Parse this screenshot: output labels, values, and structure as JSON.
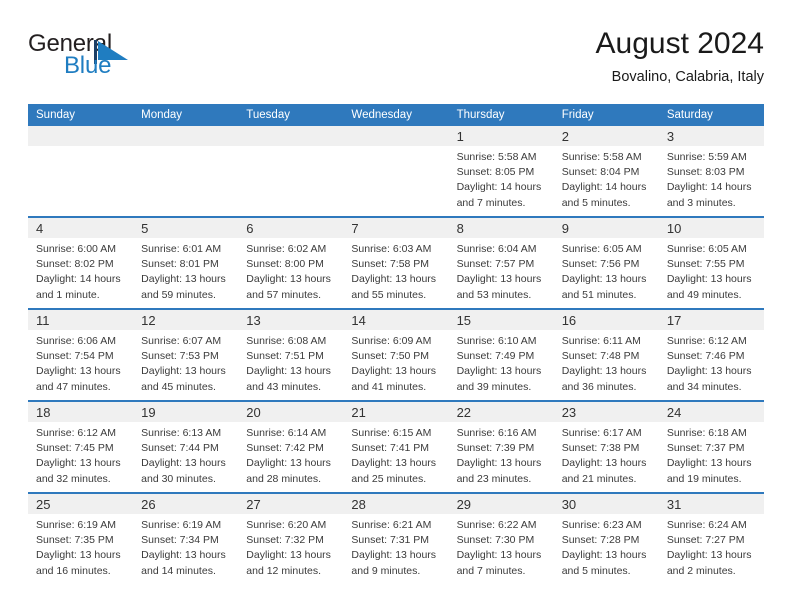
{
  "brand": {
    "name_top": "General",
    "name_bottom": "Blue",
    "flag_icon": "blue-triangle-flag-icon",
    "color_top": "#231f20",
    "color_bottom": "#1f7dc1"
  },
  "header": {
    "title": "August 2024",
    "location": "Bovalino, Calabria, Italy"
  },
  "colors": {
    "header_row_background": "#2f79bd",
    "header_row_text": "#ffffff",
    "date_band_background": "#f0f0f0",
    "week_separator": "#2f79bd",
    "body_text": "#3b3b3b"
  },
  "calendar": {
    "weekday_headers": [
      "Sunday",
      "Monday",
      "Tuesday",
      "Wednesday",
      "Thursday",
      "Friday",
      "Saturday"
    ],
    "weeks": [
      [
        {
          "day": "",
          "lines": []
        },
        {
          "day": "",
          "lines": []
        },
        {
          "day": "",
          "lines": []
        },
        {
          "day": "",
          "lines": []
        },
        {
          "day": "1",
          "lines": [
            "Sunrise: 5:58 AM",
            "Sunset: 8:05 PM",
            "Daylight: 14 hours",
            "and 7 minutes."
          ]
        },
        {
          "day": "2",
          "lines": [
            "Sunrise: 5:58 AM",
            "Sunset: 8:04 PM",
            "Daylight: 14 hours",
            "and 5 minutes."
          ]
        },
        {
          "day": "3",
          "lines": [
            "Sunrise: 5:59 AM",
            "Sunset: 8:03 PM",
            "Daylight: 14 hours",
            "and 3 minutes."
          ]
        }
      ],
      [
        {
          "day": "4",
          "lines": [
            "Sunrise: 6:00 AM",
            "Sunset: 8:02 PM",
            "Daylight: 14 hours",
            "and 1 minute."
          ]
        },
        {
          "day": "5",
          "lines": [
            "Sunrise: 6:01 AM",
            "Sunset: 8:01 PM",
            "Daylight: 13 hours",
            "and 59 minutes."
          ]
        },
        {
          "day": "6",
          "lines": [
            "Sunrise: 6:02 AM",
            "Sunset: 8:00 PM",
            "Daylight: 13 hours",
            "and 57 minutes."
          ]
        },
        {
          "day": "7",
          "lines": [
            "Sunrise: 6:03 AM",
            "Sunset: 7:58 PM",
            "Daylight: 13 hours",
            "and 55 minutes."
          ]
        },
        {
          "day": "8",
          "lines": [
            "Sunrise: 6:04 AM",
            "Sunset: 7:57 PM",
            "Daylight: 13 hours",
            "and 53 minutes."
          ]
        },
        {
          "day": "9",
          "lines": [
            "Sunrise: 6:05 AM",
            "Sunset: 7:56 PM",
            "Daylight: 13 hours",
            "and 51 minutes."
          ]
        },
        {
          "day": "10",
          "lines": [
            "Sunrise: 6:05 AM",
            "Sunset: 7:55 PM",
            "Daylight: 13 hours",
            "and 49 minutes."
          ]
        }
      ],
      [
        {
          "day": "11",
          "lines": [
            "Sunrise: 6:06 AM",
            "Sunset: 7:54 PM",
            "Daylight: 13 hours",
            "and 47 minutes."
          ]
        },
        {
          "day": "12",
          "lines": [
            "Sunrise: 6:07 AM",
            "Sunset: 7:53 PM",
            "Daylight: 13 hours",
            "and 45 minutes."
          ]
        },
        {
          "day": "13",
          "lines": [
            "Sunrise: 6:08 AM",
            "Sunset: 7:51 PM",
            "Daylight: 13 hours",
            "and 43 minutes."
          ]
        },
        {
          "day": "14",
          "lines": [
            "Sunrise: 6:09 AM",
            "Sunset: 7:50 PM",
            "Daylight: 13 hours",
            "and 41 minutes."
          ]
        },
        {
          "day": "15",
          "lines": [
            "Sunrise: 6:10 AM",
            "Sunset: 7:49 PM",
            "Daylight: 13 hours",
            "and 39 minutes."
          ]
        },
        {
          "day": "16",
          "lines": [
            "Sunrise: 6:11 AM",
            "Sunset: 7:48 PM",
            "Daylight: 13 hours",
            "and 36 minutes."
          ]
        },
        {
          "day": "17",
          "lines": [
            "Sunrise: 6:12 AM",
            "Sunset: 7:46 PM",
            "Daylight: 13 hours",
            "and 34 minutes."
          ]
        }
      ],
      [
        {
          "day": "18",
          "lines": [
            "Sunrise: 6:12 AM",
            "Sunset: 7:45 PM",
            "Daylight: 13 hours",
            "and 32 minutes."
          ]
        },
        {
          "day": "19",
          "lines": [
            "Sunrise: 6:13 AM",
            "Sunset: 7:44 PM",
            "Daylight: 13 hours",
            "and 30 minutes."
          ]
        },
        {
          "day": "20",
          "lines": [
            "Sunrise: 6:14 AM",
            "Sunset: 7:42 PM",
            "Daylight: 13 hours",
            "and 28 minutes."
          ]
        },
        {
          "day": "21",
          "lines": [
            "Sunrise: 6:15 AM",
            "Sunset: 7:41 PM",
            "Daylight: 13 hours",
            "and 25 minutes."
          ]
        },
        {
          "day": "22",
          "lines": [
            "Sunrise: 6:16 AM",
            "Sunset: 7:39 PM",
            "Daylight: 13 hours",
            "and 23 minutes."
          ]
        },
        {
          "day": "23",
          "lines": [
            "Sunrise: 6:17 AM",
            "Sunset: 7:38 PM",
            "Daylight: 13 hours",
            "and 21 minutes."
          ]
        },
        {
          "day": "24",
          "lines": [
            "Sunrise: 6:18 AM",
            "Sunset: 7:37 PM",
            "Daylight: 13 hours",
            "and 19 minutes."
          ]
        }
      ],
      [
        {
          "day": "25",
          "lines": [
            "Sunrise: 6:19 AM",
            "Sunset: 7:35 PM",
            "Daylight: 13 hours",
            "and 16 minutes."
          ]
        },
        {
          "day": "26",
          "lines": [
            "Sunrise: 6:19 AM",
            "Sunset: 7:34 PM",
            "Daylight: 13 hours",
            "and 14 minutes."
          ]
        },
        {
          "day": "27",
          "lines": [
            "Sunrise: 6:20 AM",
            "Sunset: 7:32 PM",
            "Daylight: 13 hours",
            "and 12 minutes."
          ]
        },
        {
          "day": "28",
          "lines": [
            "Sunrise: 6:21 AM",
            "Sunset: 7:31 PM",
            "Daylight: 13 hours",
            "and 9 minutes."
          ]
        },
        {
          "day": "29",
          "lines": [
            "Sunrise: 6:22 AM",
            "Sunset: 7:30 PM",
            "Daylight: 13 hours",
            "and 7 minutes."
          ]
        },
        {
          "day": "30",
          "lines": [
            "Sunrise: 6:23 AM",
            "Sunset: 7:28 PM",
            "Daylight: 13 hours",
            "and 5 minutes."
          ]
        },
        {
          "day": "31",
          "lines": [
            "Sunrise: 6:24 AM",
            "Sunset: 7:27 PM",
            "Daylight: 13 hours",
            "and 2 minutes."
          ]
        }
      ]
    ]
  }
}
